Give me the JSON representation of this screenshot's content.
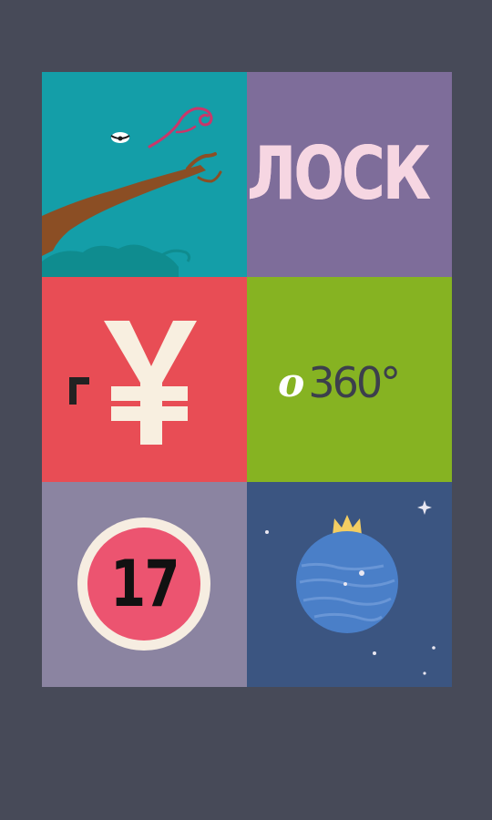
{
  "tiles": [
    {
      "name": "bird-branch",
      "color": "#149ea8"
    },
    {
      "name": "lock",
      "color": "#7e6d9a",
      "label": "ЛОСК"
    },
    {
      "name": "yen",
      "color": "#e84d55",
      "symbol": "¥",
      "corner": "г"
    },
    {
      "name": "360",
      "color": "#86b322",
      "prefix": "o",
      "label": "360°"
    },
    {
      "name": "day-17",
      "color": "#8b84a1",
      "label": "17"
    },
    {
      "name": "ornament",
      "color": "#3b5581"
    }
  ],
  "colors": {
    "background": "#474a58",
    "accent_pink": "#f6d6e2",
    "circle_pink": "#ec5470",
    "ornament_blue": "#4a7fc8",
    "crown_gold": "#f3cd62"
  }
}
